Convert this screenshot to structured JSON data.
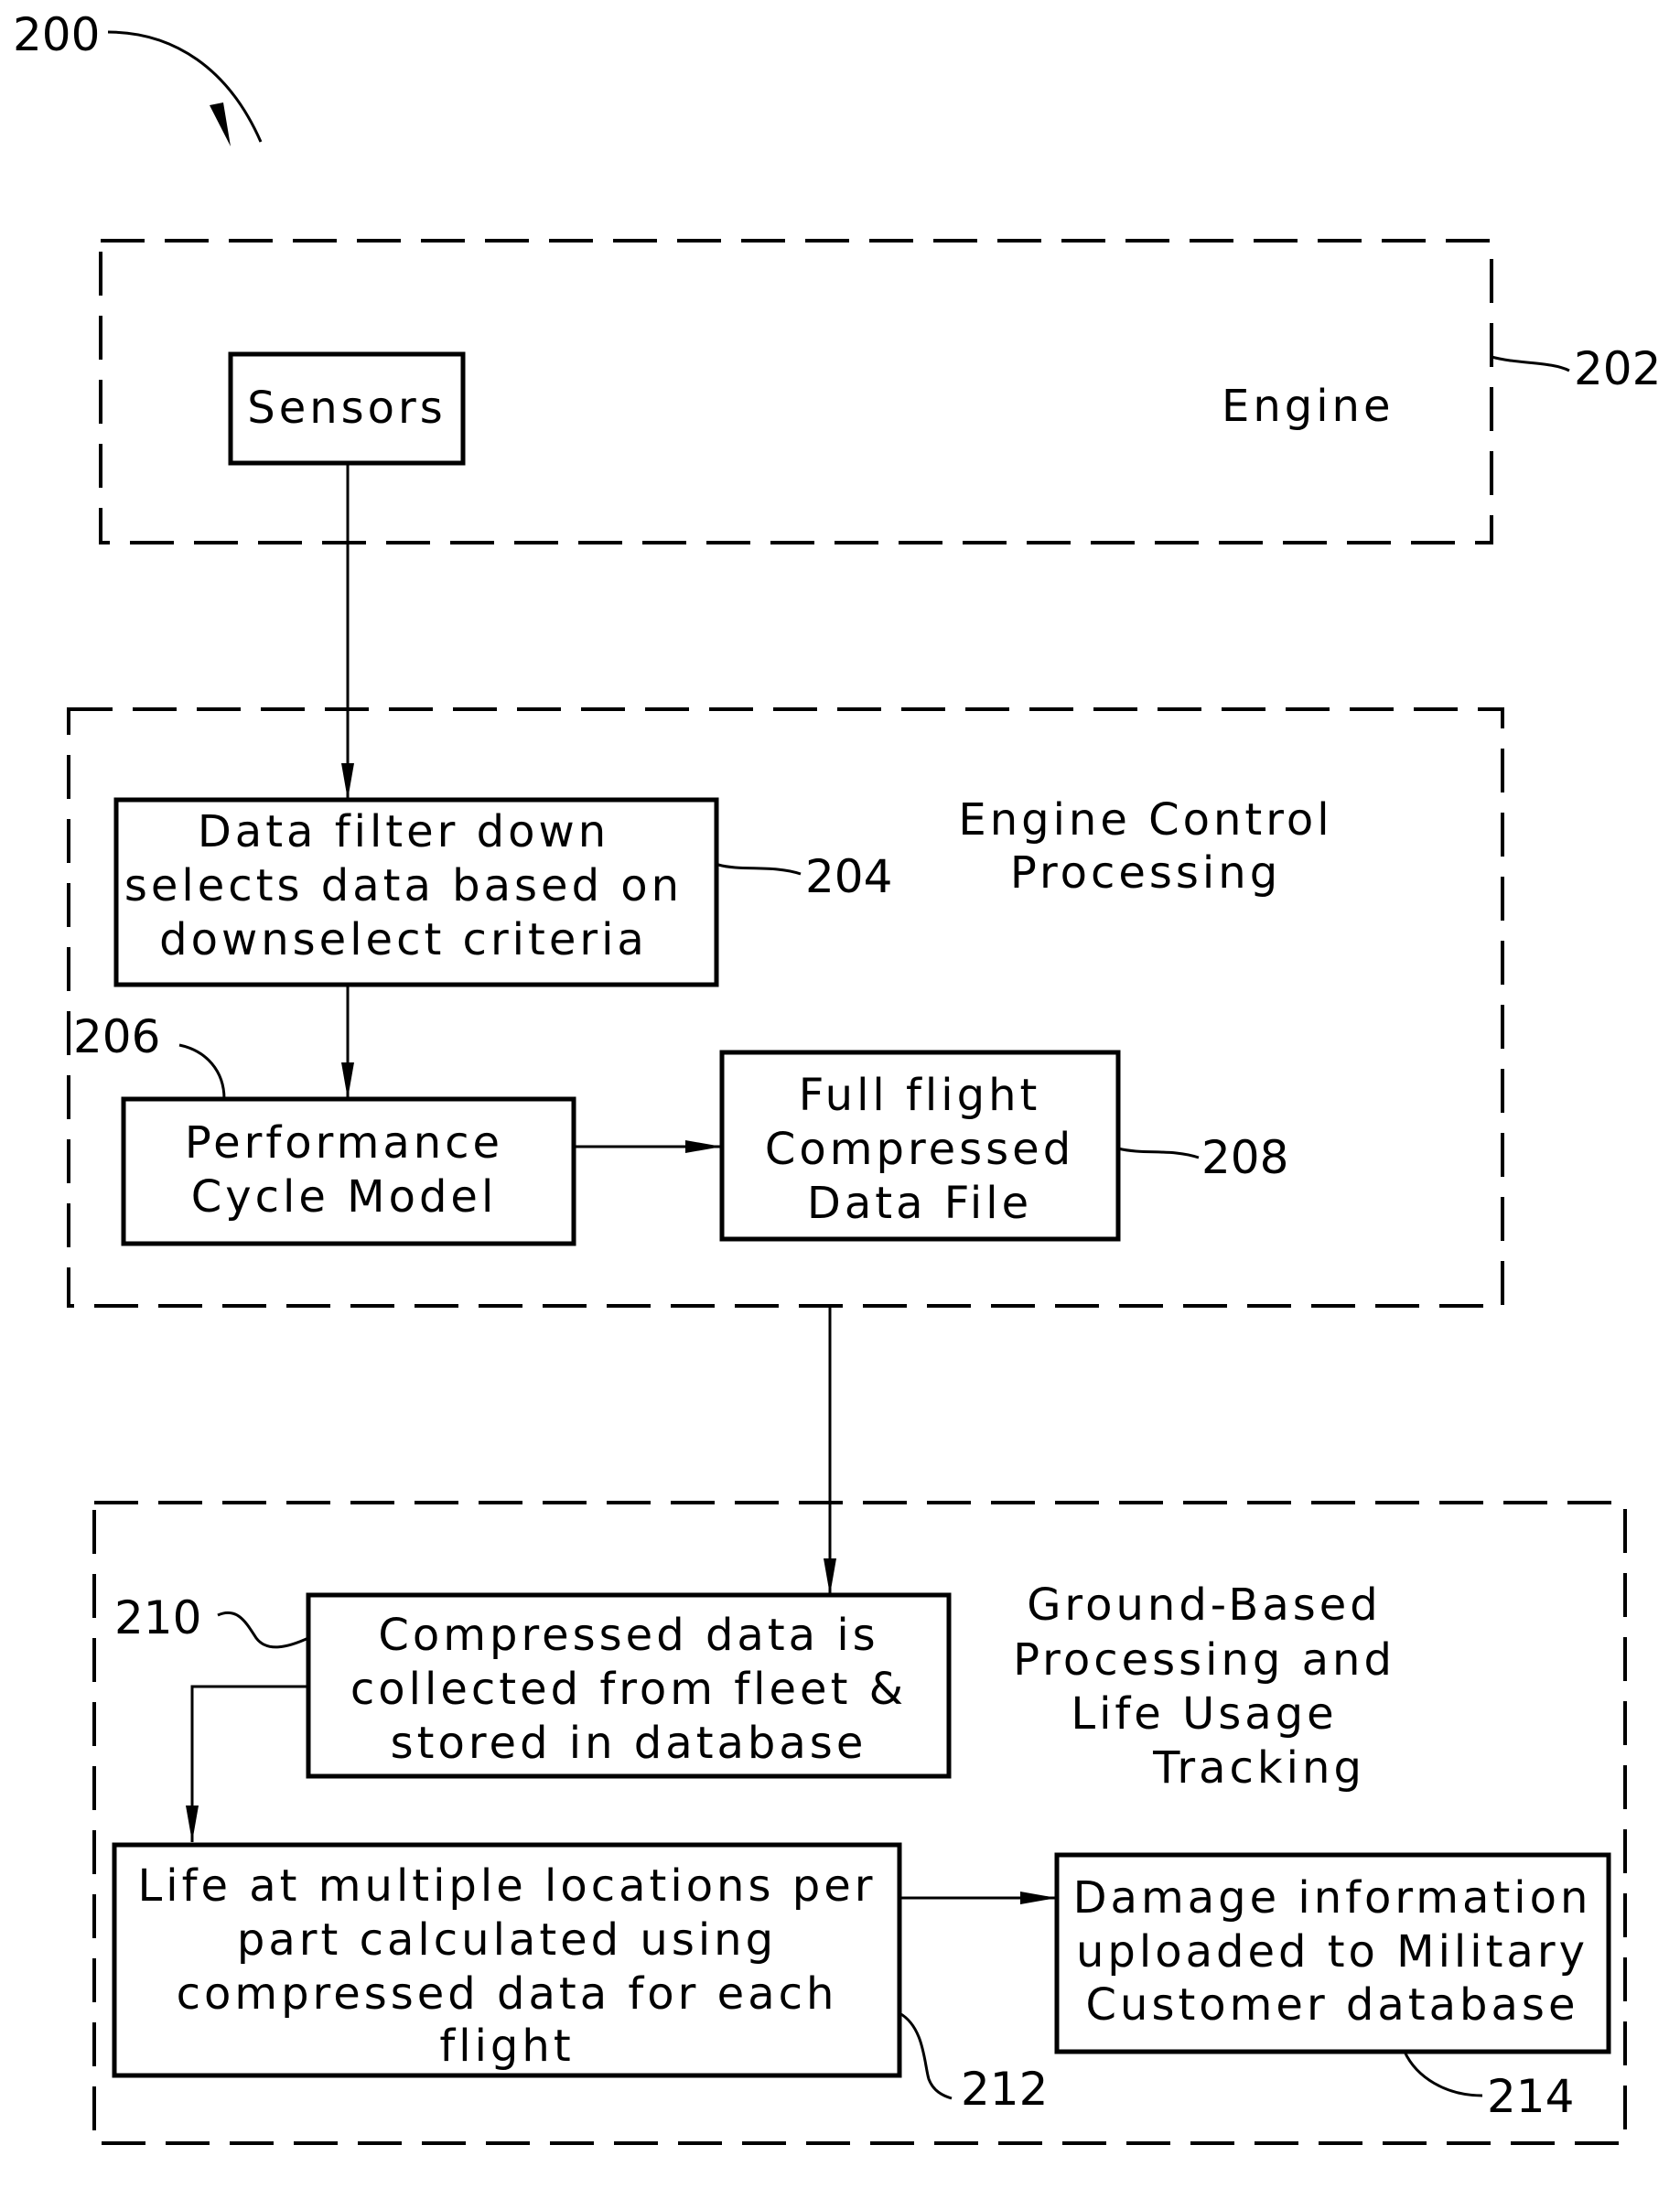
{
  "figure": {
    "reference": "200",
    "sections": [
      {
        "id": "engine",
        "ref": "202",
        "title_lines": [
          "Engine"
        ]
      },
      {
        "id": "engine-control",
        "ref": "",
        "title_lines": [
          "Engine Control",
          "Processing"
        ]
      },
      {
        "id": "ground",
        "ref": "",
        "title_lines": [
          "Ground-Based",
          "Processing and",
          "Life Usage",
          "Tracking"
        ]
      }
    ],
    "blocks": [
      {
        "id": "sensors",
        "ref": "",
        "lines": [
          "Sensors"
        ]
      },
      {
        "id": "data-filter",
        "ref": "204",
        "lines": [
          "Data filter down",
          "selects data based on",
          "downselect criteria"
        ]
      },
      {
        "id": "performance-cycle-model",
        "ref": "206",
        "lines": [
          "Performance",
          "Cycle Model"
        ]
      },
      {
        "id": "compressed-data-file",
        "ref": "208",
        "lines": [
          "Full flight",
          "Compressed",
          "Data File"
        ]
      },
      {
        "id": "fleet-database",
        "ref": "210",
        "lines": [
          "Compressed data is",
          "collected from fleet &",
          "stored in database"
        ]
      },
      {
        "id": "life-calculation",
        "ref": "212",
        "lines": [
          "Life at multiple locations per",
          "part calculated using",
          "compressed data for each",
          "flight"
        ]
      },
      {
        "id": "damage-upload",
        "ref": "214",
        "lines": [
          "Damage information",
          "uploaded to Military",
          "Customer database"
        ]
      }
    ],
    "connections": [
      {
        "from": "sensors",
        "to": "data-filter"
      },
      {
        "from": "data-filter",
        "to": "performance-cycle-model"
      },
      {
        "from": "performance-cycle-model",
        "to": "compressed-data-file"
      },
      {
        "from": "engine-control",
        "to": "fleet-database"
      },
      {
        "from": "fleet-database",
        "to": "life-calculation"
      },
      {
        "from": "life-calculation",
        "to": "damage-upload"
      }
    ]
  }
}
